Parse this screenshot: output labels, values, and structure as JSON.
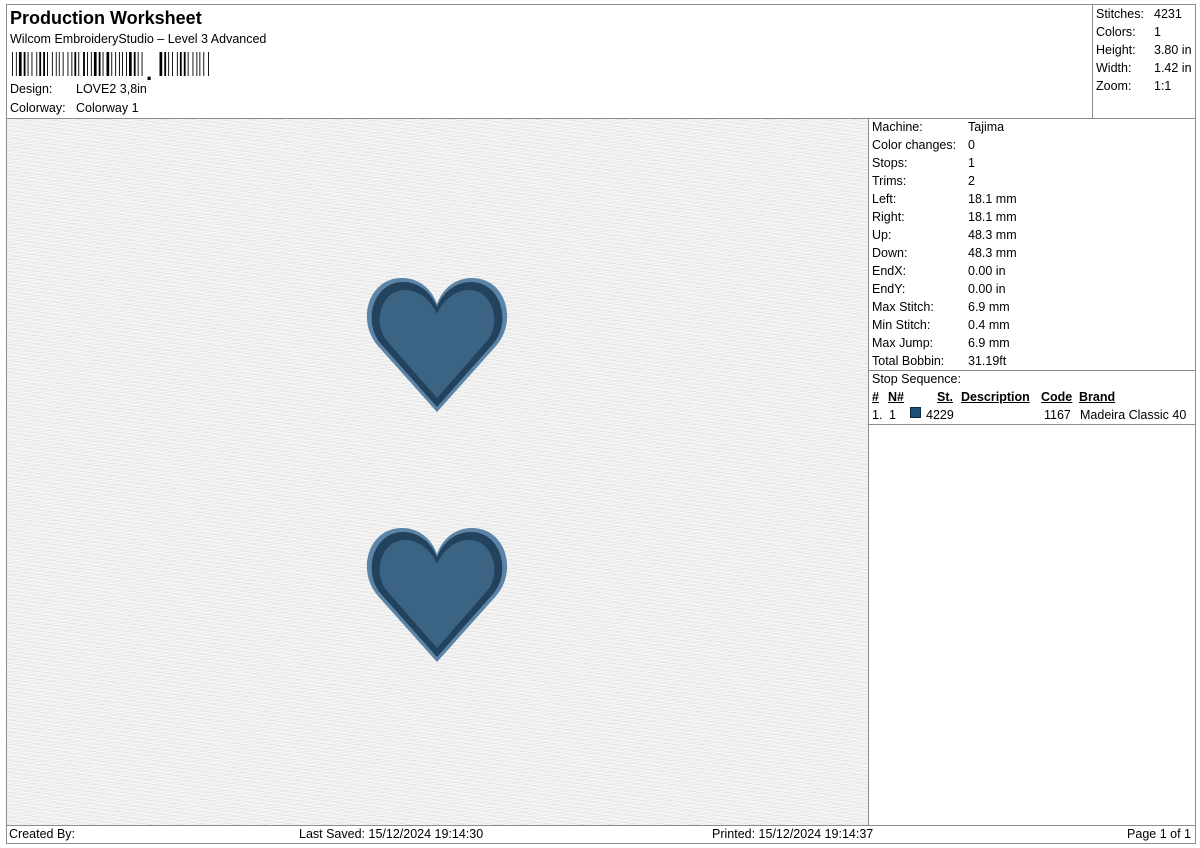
{
  "header": {
    "title": "Production Worksheet",
    "subtitle": "Wilcom EmbroideryStudio – Level 3 Advanced",
    "design_label": "Design:",
    "design_value": "LOVE2  3,8in",
    "colorway_label": "Colorway:",
    "colorway_value": "Colorway 1"
  },
  "stats": [
    {
      "label": "Stitches:",
      "value": "4231"
    },
    {
      "label": "Colors:",
      "value": "1"
    },
    {
      "label": "Height:",
      "value": "3.80 in"
    },
    {
      "label": "Width:",
      "value": "1.42 in"
    },
    {
      "label": "Zoom:",
      "value": "1:1"
    }
  ],
  "properties": [
    {
      "label": "Machine:",
      "value": "Tajima"
    },
    {
      "label": "Color changes:",
      "value": "0"
    },
    {
      "label": "Stops:",
      "value": "1"
    },
    {
      "label": "Trims:",
      "value": "2"
    },
    {
      "label": "Left:",
      "value": "18.1 mm"
    },
    {
      "label": "Right:",
      "value": "18.1 mm"
    },
    {
      "label": "Up:",
      "value": "48.3 mm"
    },
    {
      "label": "Down:",
      "value": "48.3 mm"
    },
    {
      "label": "EndX:",
      "value": "0.00 in"
    },
    {
      "label": "EndY:",
      "value": "0.00 in"
    },
    {
      "label": "Max Stitch:",
      "value": "6.9 mm"
    },
    {
      "label": "Min Stitch:",
      "value": "0.4 mm"
    },
    {
      "label": "Max Jump:",
      "value": "6.9 mm"
    },
    {
      "label": "Total Bobbin:",
      "value": "31.19ft"
    }
  ],
  "stop_sequence": {
    "title": "Stop Sequence:",
    "headers": {
      "num": "#",
      "n": "N#",
      "st": "St.",
      "description": "Description",
      "code": "Code",
      "brand": "Brand"
    },
    "rows": [
      {
        "num": "1.",
        "n": "1",
        "swatch_color": "#1f4e79",
        "st": "4229",
        "description": "",
        "code": "1167",
        "brand": "Madeira Classic 40"
      }
    ]
  },
  "design_colors": {
    "fill": "#3b6484",
    "border": "#23425e",
    "edge": "#5b84a6"
  },
  "footer": {
    "created_by": "Created By:",
    "last_saved": "Last Saved: 15/12/2024 19:14:30",
    "printed": "Printed: 15/12/2024 19:14:37",
    "page": "Page 1 of 1"
  }
}
